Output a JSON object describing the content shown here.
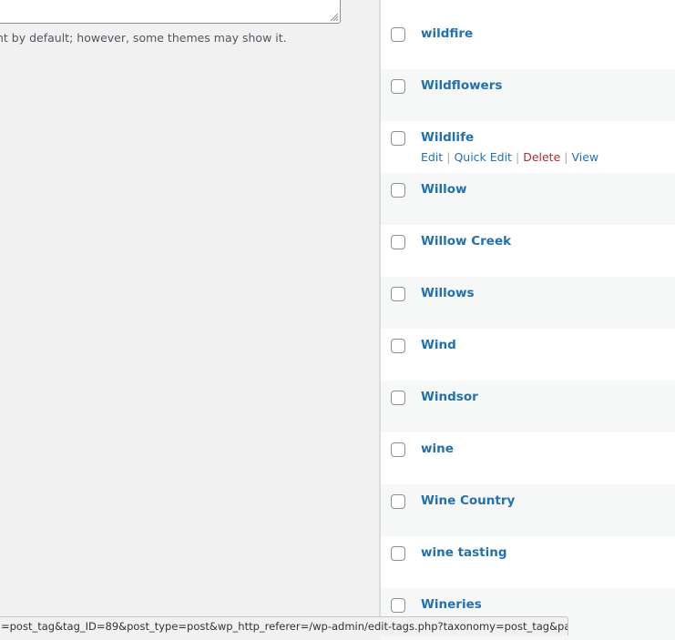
{
  "description_help": "nt by default; however, some themes may show it.",
  "tags": [
    {
      "name": ""
    },
    {
      "name": "wildfire"
    },
    {
      "name": "Wildflowers"
    },
    {
      "name": "Wildlife"
    },
    {
      "name": "Willow"
    },
    {
      "name": "Willow Creek"
    },
    {
      "name": "Willows"
    },
    {
      "name": "Wind"
    },
    {
      "name": "Windsor"
    },
    {
      "name": "wine"
    },
    {
      "name": "Wine Country"
    },
    {
      "name": "wine tasting"
    },
    {
      "name": "Wineries"
    }
  ],
  "row_actions": {
    "edit": "Edit",
    "quick_edit": "Quick Edit",
    "delete": "Delete",
    "view": "View",
    "separator": "|"
  },
  "status_url": "=post_tag&tag_ID=89&post_type=post&wp_http_referer=/wp-admin/edit-tags.php?taxonomy=post_tag&paged=67",
  "colors": {
    "link": "#2271b1",
    "delete": "#b32d2e",
    "row_alt": "#f6f7f7",
    "row": "#ffffff",
    "page_bg": "#f1f1f1"
  }
}
